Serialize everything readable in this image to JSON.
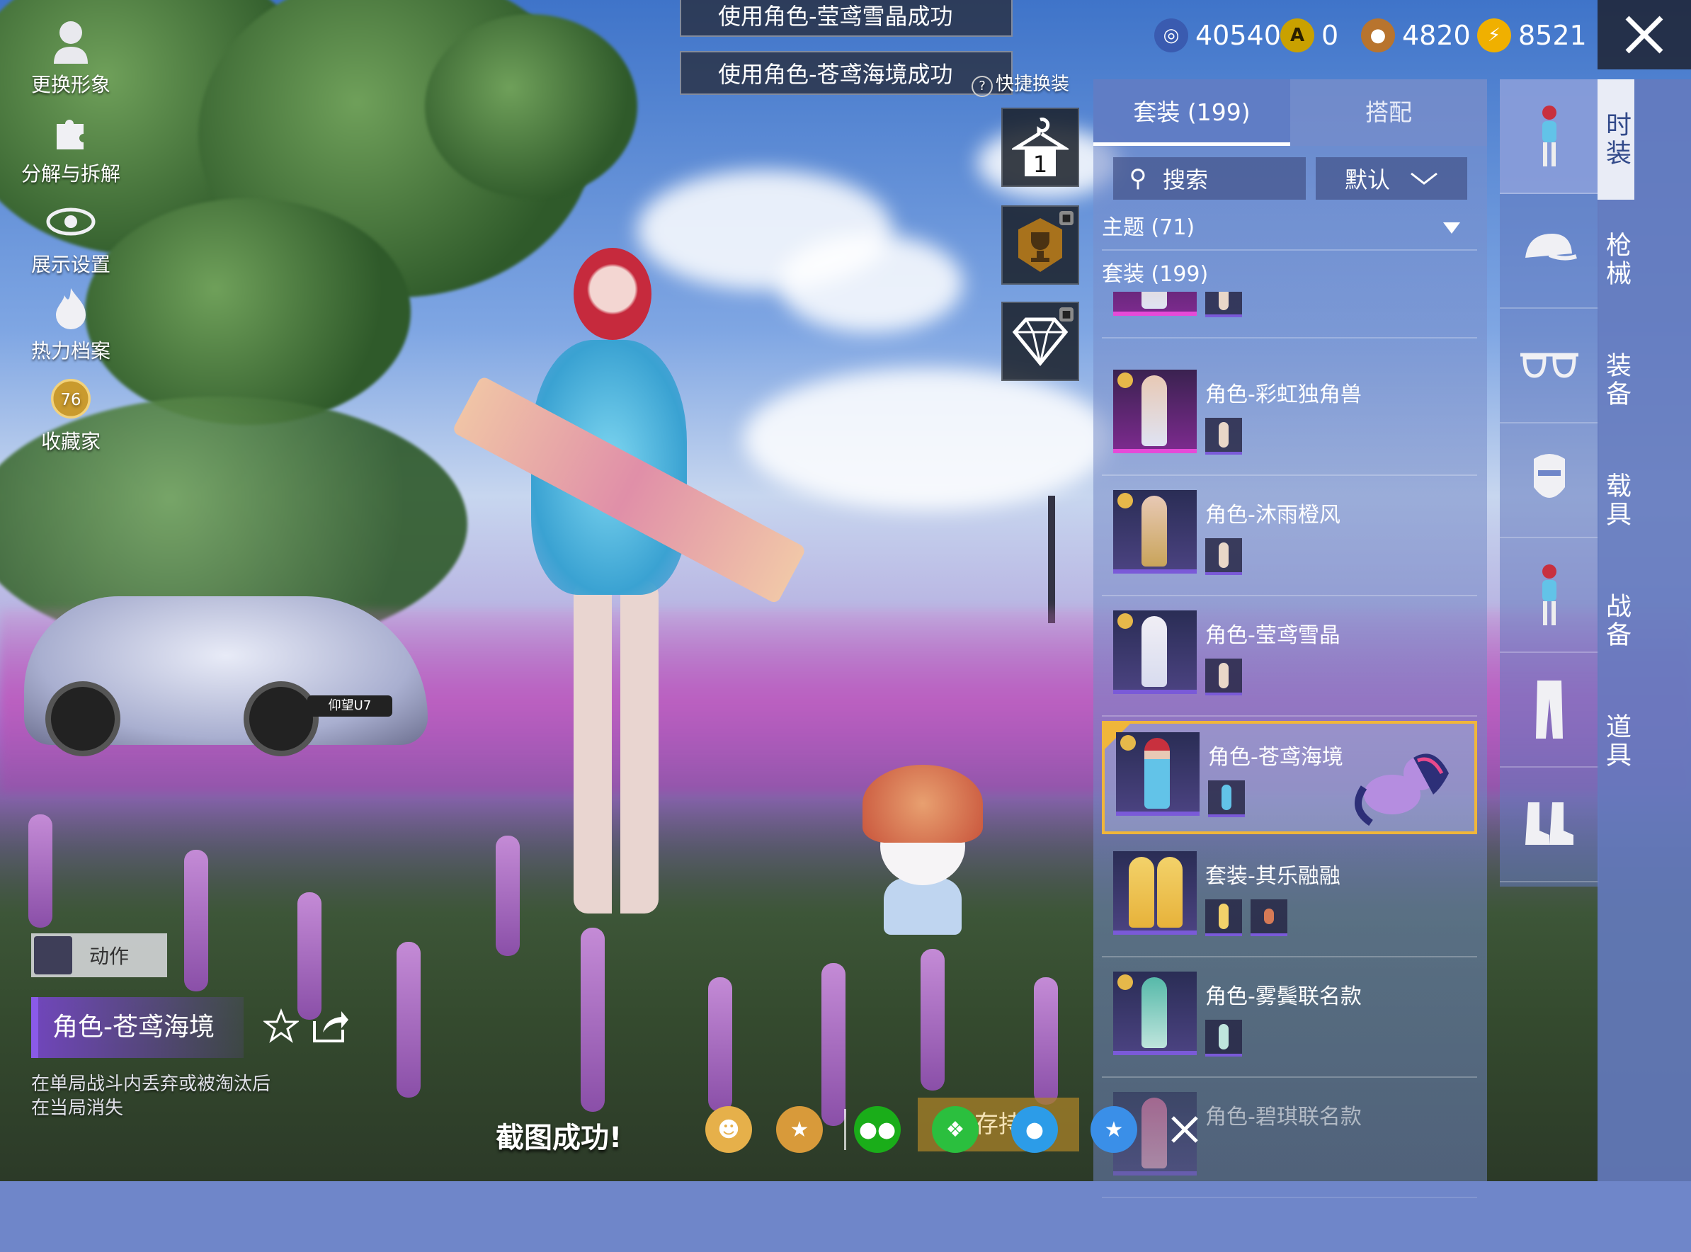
{
  "left_tools": [
    {
      "label": "更换形象",
      "icon": "person-icon"
    },
    {
      "label": "分解与拆解",
      "icon": "puzzle-icon"
    },
    {
      "label": "展示设置",
      "icon": "eye-icon"
    },
    {
      "label": "热力档案",
      "icon": "flame-icon"
    },
    {
      "label": "收藏家",
      "icon": "collector-badge-icon",
      "badge_value": "76"
    }
  ],
  "toasts": [
    "使用角色-莹鸢雪晶成功",
    "使用角色-苍鸢海境成功"
  ],
  "quick_change": {
    "label": "快捷换装",
    "help": "?",
    "hanger_number": "1"
  },
  "currency": [
    {
      "value": "40540",
      "color": "#3a5bb0"
    },
    {
      "value": "0",
      "color": "#c9a100"
    },
    {
      "value": "4820",
      "color": "#b8742e"
    },
    {
      "value": "8521",
      "color": "#f0b000"
    }
  ],
  "panel": {
    "tabs": [
      "套装 (199)",
      "搭配"
    ],
    "search_placeholder": "搜索",
    "sort_label": "默认",
    "theme_row": "主题 (71)",
    "suit_row": "套装 (199)",
    "items": [
      {
        "name": "角色-彩虹独角兽",
        "style": "pink",
        "minis": 1
      },
      {
        "name": "角色-沐雨橙风",
        "style": "normal",
        "minis": 1
      },
      {
        "name": "角色-莹鸢雪晶",
        "style": "normal",
        "minis": 1
      },
      {
        "name": "角色-苍鸢海境",
        "style": "normal",
        "minis": 1,
        "selected": true
      },
      {
        "name": "套装-其乐融融",
        "style": "normal",
        "minis": 2
      },
      {
        "name": "角色-雾鬓联名款",
        "style": "normal",
        "minis": 1
      },
      {
        "name": "角色-碧琪联名款",
        "style": "normal",
        "minis": 1
      }
    ]
  },
  "categories": [
    "outfit-icon",
    "cap-icon",
    "glasses-icon",
    "mask-icon",
    "character-icon",
    "pants-icon",
    "boots-icon"
  ],
  "main_nav": [
    "时装",
    "枪械",
    "装备",
    "载具",
    "战备",
    "道具"
  ],
  "bottom": {
    "motion_label": "动作",
    "current_outfit": "角色-苍鸢海境",
    "description_line1": "在单局战斗内丢弃或被淘汰后",
    "description_line2": "在当局消失",
    "screenshot_message": "截图成功!",
    "save_label": "存持",
    "share_icons": [
      {
        "name": "contact-share-icon",
        "color": "#e6b04a"
      },
      {
        "name": "peace-elite-share-icon",
        "color": "#d89a3a"
      },
      {
        "name": "wechat-icon",
        "color": "#1aad19"
      },
      {
        "name": "moments-icon",
        "color": "#2bbf3e"
      },
      {
        "name": "qq-icon",
        "color": "#2c9ce8"
      },
      {
        "name": "qzone-icon",
        "color": "#3a8fe8"
      }
    ]
  },
  "car_plate": "仰望U7"
}
